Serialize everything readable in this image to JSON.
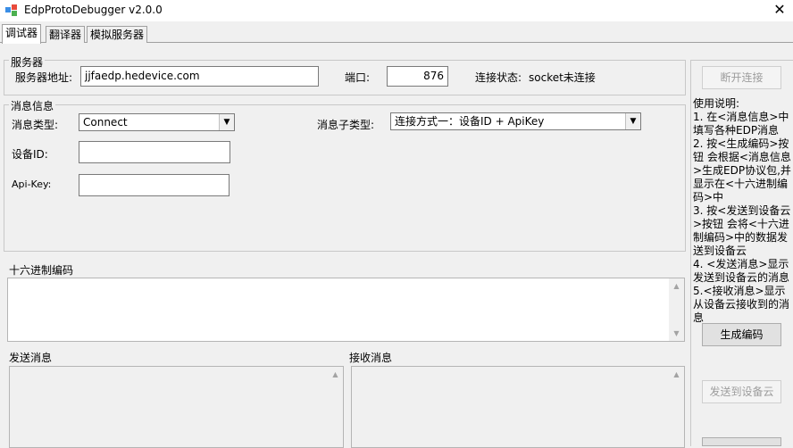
{
  "window": {
    "title": "EdpProtoDebugger v2.0.0",
    "close_glyph": "✕"
  },
  "tabs": [
    {
      "label": "调试器"
    },
    {
      "label": "翻译器"
    },
    {
      "label": "模拟服务器"
    }
  ],
  "server": {
    "group_label": "服务器",
    "address_label": "服务器地址:",
    "address_value": "jjfaedp.hedevice.com",
    "port_label": "端口:",
    "port_value": "876",
    "status_label": "连接状态:",
    "status_value": "socket未连接"
  },
  "message": {
    "group_label": "消息信息",
    "type_label": "消息类型:",
    "type_value": "Connect",
    "subtype_label": "消息子类型:",
    "subtype_value": "连接方式一：设备ID + ApiKey",
    "device_id_label": "设备ID:",
    "device_id_value": "",
    "apikey_label": "Api-Key:",
    "apikey_value": ""
  },
  "hex": {
    "label": "十六进制编码"
  },
  "send": {
    "label": "发送消息"
  },
  "receive": {
    "label": "接收消息"
  },
  "buttons": {
    "disconnect": "断开连接",
    "generate": "生成编码",
    "send_cloud": "发送到设备云"
  },
  "help": {
    "title": "使用说明:",
    "lines": [
      "1. 在<消息信息>中填写各种EDP消息",
      "2. 按<生成编码>按钮 会根据<消息信息>生成EDP协议包,并显示在<十六进制编码>中",
      "3. 按<发送到设备云>按钮 会将<十六进制编码>中的数据发送到设备云",
      "4. <发送消息>显示发送到设备云的消息",
      "5.<接收消息>显示从设备云接收到的消息"
    ]
  }
}
